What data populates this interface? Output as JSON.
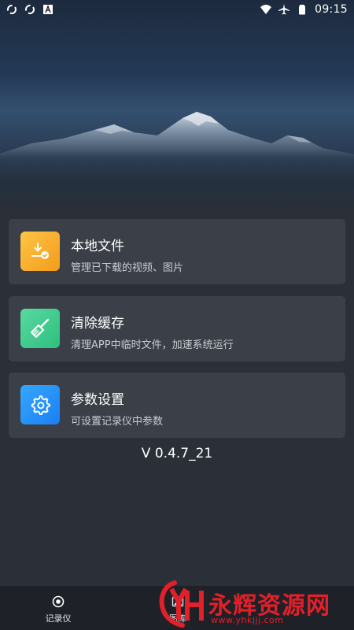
{
  "status_bar": {
    "time": "09:15",
    "left_icons": [
      "sync-icon",
      "sync-icon",
      "font-icon"
    ],
    "right_icons": [
      "wifi-icon",
      "airplane-icon",
      "battery-icon"
    ]
  },
  "menu": [
    {
      "title": "本地文件",
      "description": "管理已下载的视频、图片",
      "icon": "download-icon",
      "color": "#f6a626"
    },
    {
      "title": "清除缓存",
      "description": "清理APP中临时文件，加速系统运行",
      "icon": "broom-icon",
      "color": "#3ec98a"
    },
    {
      "title": "参数设置",
      "description": "可设置记录仪中参数",
      "icon": "gear-icon",
      "color": "#2590f8"
    }
  ],
  "version": "V 0.4.7_21",
  "bottom_nav": {
    "items": [
      {
        "label": "记录仪",
        "icon": "record-icon"
      },
      {
        "label": "图库",
        "icon": "gallery-icon"
      }
    ]
  },
  "watermark": {
    "text": "永辉资源网",
    "url": "www.yhkjjj.com",
    "logo_text": "YH"
  }
}
